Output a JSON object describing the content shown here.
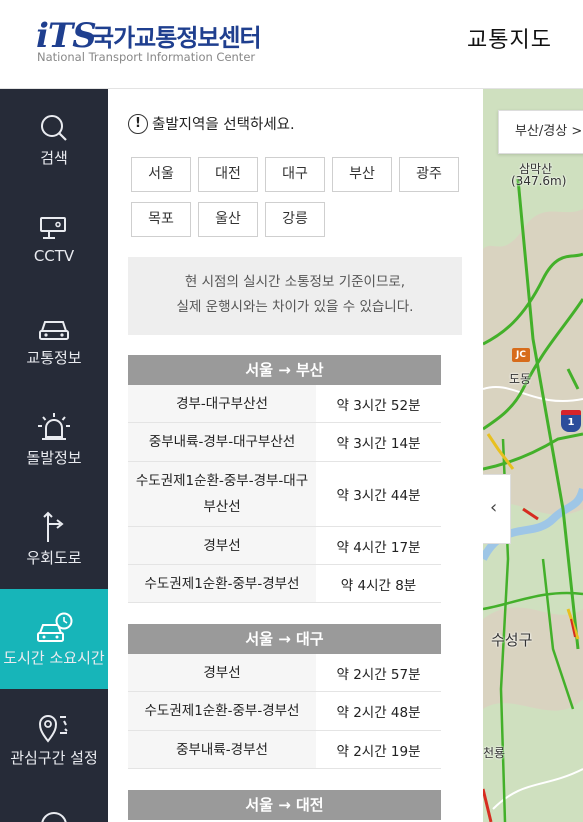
{
  "header": {
    "logo_mark": "iTS",
    "logo_ko": "국가교통정보센터",
    "logo_en": "National Transport Information Center",
    "page_title": "교통지도"
  },
  "sidebar": {
    "items": [
      {
        "label": "검색",
        "icon": "search-icon",
        "active": false
      },
      {
        "label": "CCTV",
        "icon": "cctv-icon",
        "active": false
      },
      {
        "label": "교통정보",
        "icon": "car-icon",
        "active": false
      },
      {
        "label": "돌발정보",
        "icon": "siren-icon",
        "active": false
      },
      {
        "label": "우회도로",
        "icon": "detour-icon",
        "active": false
      },
      {
        "label": "도시간 소요시간",
        "icon": "car-clock-icon",
        "active": true
      },
      {
        "label": "관심구간 설정",
        "icon": "location-pin-icon",
        "active": false
      }
    ],
    "active_color": "#17b5b9",
    "background": "#262b38"
  },
  "panel": {
    "prompt": "출발지역을 선택하세요.",
    "regions": [
      "서울",
      "대전",
      "대구",
      "부산",
      "광주",
      "목포",
      "울산",
      "강릉"
    ],
    "notice_line1": "현 시점의 실시간 소통정보 기준이므로,",
    "notice_line2": "실제 운행시와는 차이가 있을 수 있습니다.",
    "routes": [
      {
        "title": "서울 → 부산",
        "rows": [
          {
            "name": "경부-대구부산선",
            "time": "약 3시간 52분"
          },
          {
            "name": "중부내륙-경부-대구부산선",
            "time": "약 3시간 14분"
          },
          {
            "name": "수도권제1순환-중부-경부-대구부산선",
            "time": "약 3시간 44분"
          },
          {
            "name": "경부선",
            "time": "약 4시간 17분"
          },
          {
            "name": "수도권제1순환-중부-경부선",
            "time": "약 4시간 8분"
          }
        ]
      },
      {
        "title": "서울 → 대구",
        "rows": [
          {
            "name": "경부선",
            "time": "약 2시간 57분"
          },
          {
            "name": "수도권제1순환-중부-경부선",
            "time": "약 2시간 48분"
          },
          {
            "name": "중부내륙-경부선",
            "time": "약 2시간 19분"
          }
        ]
      },
      {
        "title": "서울 → 대전",
        "rows": []
      }
    ]
  },
  "map": {
    "tab_label": "부산/경상 >",
    "labels": [
      "삼막산",
      "(347.6m)",
      "도동",
      "수성구",
      "천룡"
    ],
    "jc_label": "JC",
    "shield_label": "1",
    "collapse_icon": "chevron-left-icon"
  }
}
